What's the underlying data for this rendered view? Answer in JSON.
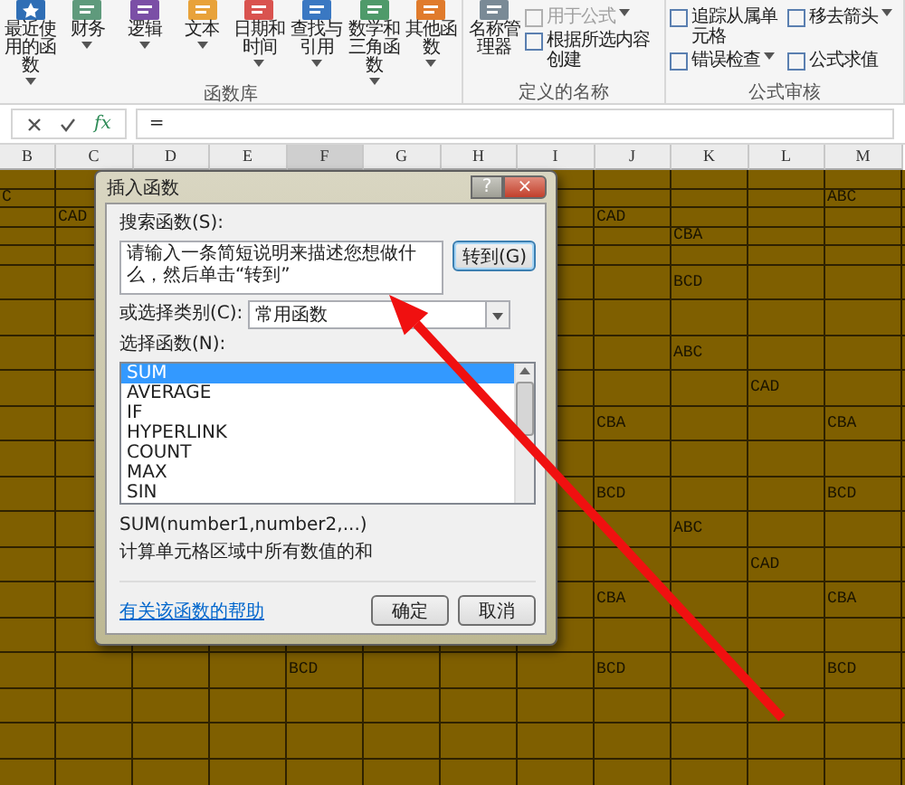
{
  "ribbon": {
    "groups": [
      {
        "label": "函数库",
        "buttons": [
          {
            "label": "最近使用的函数",
            "dropdown": true,
            "color": "#2f6eb5"
          },
          {
            "label": "财务",
            "dropdown": true,
            "color": "#5f9a7c"
          },
          {
            "label": "逻辑",
            "dropdown": true,
            "color": "#7b4fa6"
          },
          {
            "label": "文本",
            "dropdown": true,
            "color": "#e8a23a"
          },
          {
            "label": "日期和时间",
            "dropdown": true,
            "color": "#d9534f"
          },
          {
            "label": "查找与引用",
            "dropdown": true,
            "color": "#3a78c2"
          },
          {
            "label": "数学和三角函数",
            "dropdown": true,
            "color": "#4f9a6a"
          },
          {
            "label": "其他函数",
            "dropdown": true,
            "color": "#e07b2c"
          }
        ]
      },
      {
        "label": "定义的名称",
        "buttons": [
          {
            "label": "名称管理器",
            "dropdown": false,
            "color": "#7a8a96"
          }
        ],
        "small_items": [
          {
            "label": "用于公式",
            "dropdown": true,
            "disabled": true
          },
          {
            "label": "根据所选内容创建",
            "dropdown": false,
            "disabled": false
          }
        ]
      },
      {
        "label": "公式审核",
        "small_items": [
          {
            "label": "追踪从属单元格",
            "dropdown": false,
            "disabled": false
          },
          {
            "label": "移去箭头",
            "dropdown": true,
            "disabled": false
          },
          {
            "label": "错误检查",
            "dropdown": true,
            "disabled": false
          },
          {
            "label": "公式求值",
            "dropdown": false,
            "disabled": false
          }
        ]
      }
    ]
  },
  "formula_bar": {
    "function_label": "fx",
    "value": "="
  },
  "sheet": {
    "columns": [
      {
        "label": "B",
        "selected": false
      },
      {
        "label": "C",
        "selected": false
      },
      {
        "label": "D",
        "selected": false
      },
      {
        "label": "E",
        "selected": false
      },
      {
        "label": "F",
        "selected": true
      },
      {
        "label": "G",
        "selected": false
      },
      {
        "label": "H",
        "selected": false
      },
      {
        "label": "I",
        "selected": false
      },
      {
        "label": "J",
        "selected": false
      },
      {
        "label": "K",
        "selected": false
      },
      {
        "label": "L",
        "selected": false
      },
      {
        "label": "M",
        "selected": false
      }
    ],
    "rows": [
      {},
      {
        "B": "C",
        "M": "ABC"
      },
      {
        "C": "CAD",
        "J": "CAD"
      },
      {
        "K": "CBA"
      },
      {},
      {
        "K": "BCD"
      },
      {},
      {
        "K": "ABC"
      },
      {
        "L": "CAD"
      },
      {
        "J": "CBA",
        "M": "CBA"
      },
      {},
      {
        "J": "BCD",
        "M": "BCD"
      },
      {
        "K": "ABC"
      },
      {
        "L": "CAD"
      },
      {
        "J": "CBA",
        "M": "CBA"
      },
      {},
      {
        "F": "BCD",
        "J": "BCD",
        "M": "BCD"
      },
      {},
      {},
      {}
    ]
  },
  "dialog": {
    "title": "插入函数",
    "title_buttons": [
      "?",
      "×"
    ],
    "search_label": "搜索函数(S):",
    "search": {
      "value": "请输入一条简短说明来描述您想做什么，然后单击“转到”"
    },
    "go_button": "转到(G)",
    "category_label": "或选择类别(C):",
    "category": {
      "value": "常用函数"
    },
    "function_label": "选择函数(N):",
    "functions": [
      {
        "name": "SUM",
        "selected": true
      },
      {
        "name": "AVERAGE",
        "selected": false
      },
      {
        "name": "IF",
        "selected": false
      },
      {
        "name": "HYPERLINK",
        "selected": false
      },
      {
        "name": "COUNT",
        "selected": false
      },
      {
        "name": "MAX",
        "selected": false
      },
      {
        "name": "SIN",
        "selected": false
      }
    ],
    "signature": "SUM(number1,number2,...)",
    "description": "计算单元格区域中所有数值的和",
    "help_link": "有关该函数的帮助",
    "buttons": [
      "确定",
      "取消"
    ]
  }
}
